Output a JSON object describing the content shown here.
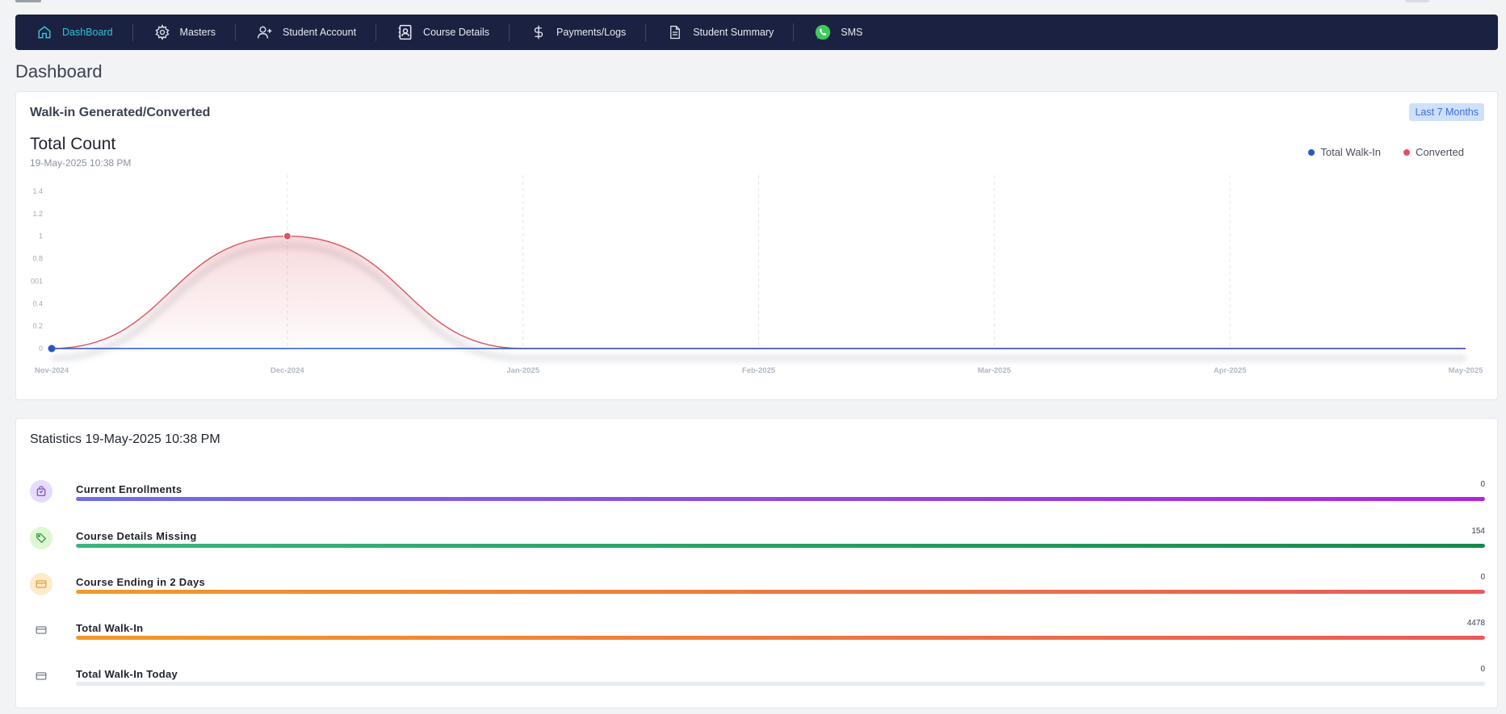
{
  "nav": {
    "items": [
      {
        "label": "DashBoard",
        "icon": "home-icon",
        "active": true
      },
      {
        "label": "Masters",
        "icon": "gear-icon"
      },
      {
        "label": "Student Account",
        "icon": "add-user-icon"
      },
      {
        "label": "Course Details",
        "icon": "contact-book-icon"
      },
      {
        "label": "Payments/Logs",
        "icon": "dollar-icon"
      },
      {
        "label": "Student Summary",
        "icon": "document-icon"
      },
      {
        "label": "SMS",
        "icon": "whatsapp-icon"
      }
    ]
  },
  "page": {
    "title": "Dashboard"
  },
  "walkin_card": {
    "title": "Walk-in Generated/Converted",
    "range_badge": "Last 7 Months",
    "heading": "Total Count",
    "subheading": "19-May-2025 10:38 PM"
  },
  "colors": {
    "nav_bg": "#1b2140",
    "nav_active": "#2fc3d9",
    "series_walkin": "#2a55c9",
    "series_converted": "#dd5560",
    "badge_bg": "#cfe0fb",
    "badge_text": "#3b6fd8"
  },
  "chart_data": {
    "type": "area",
    "x": [
      "Nov-2024",
      "Dec-2024",
      "Jan-2025",
      "Feb-2025",
      "Mar-2025",
      "Apr-2025",
      "May-2025"
    ],
    "y_ticks": [
      "0",
      "0.2",
      "0.4",
      "001",
      "0.8",
      "1",
      "1.2",
      "1.4"
    ],
    "ylim": [
      0,
      1.4
    ],
    "series": [
      {
        "name": "Total Walk-In",
        "values": [
          0,
          0,
          0,
          0,
          0,
          0,
          0
        ],
        "color": "#2a55c9"
      },
      {
        "name": "Converted",
        "values": [
          0,
          1,
          0,
          0,
          0,
          0,
          0
        ],
        "color": "#dd5560"
      }
    ],
    "legend_position": "top-right",
    "grid": "vertical-dashed"
  },
  "stats": {
    "title": "Statistics 19-May-2025 10:38 PM",
    "items": [
      {
        "label": "Current Enrollments",
        "value": "0",
        "icon": "bag-icon",
        "icon_bg": "#e6dcfa",
        "icon_color": "#7b4fd6",
        "fill_percent": 100,
        "gradient": [
          "#6f6ee8",
          "#b323d9"
        ]
      },
      {
        "label": "Course Details Missing",
        "value": "154",
        "icon": "tag-icon",
        "icon_bg": "#ddf7d2",
        "icon_color": "#2e9a4a",
        "fill_percent": 100,
        "gradient": [
          "#3cb57c",
          "#16894a"
        ]
      },
      {
        "label": "Course Ending in 2 Days",
        "value": "0",
        "icon": "card-icon",
        "icon_bg": "#fdebcc",
        "icon_color": "#d99a2b",
        "fill_percent": 100,
        "gradient": [
          "#ef9a2a",
          "#ea5a5a"
        ]
      },
      {
        "label": "Total Walk-In",
        "value": "4478",
        "icon": "card-icon",
        "icon_bg": "transparent",
        "icon_color": "#6b7280",
        "fill_percent": 100,
        "gradient": [
          "#ef9a2a",
          "#ea5a5a"
        ]
      },
      {
        "label": "Total Walk-In Today",
        "value": "0",
        "icon": "card-icon",
        "icon_bg": "transparent",
        "icon_color": "#6b7280",
        "fill_percent": 0,
        "gradient": [
          "#e8ecf3",
          "#e8ecf3"
        ]
      }
    ]
  }
}
